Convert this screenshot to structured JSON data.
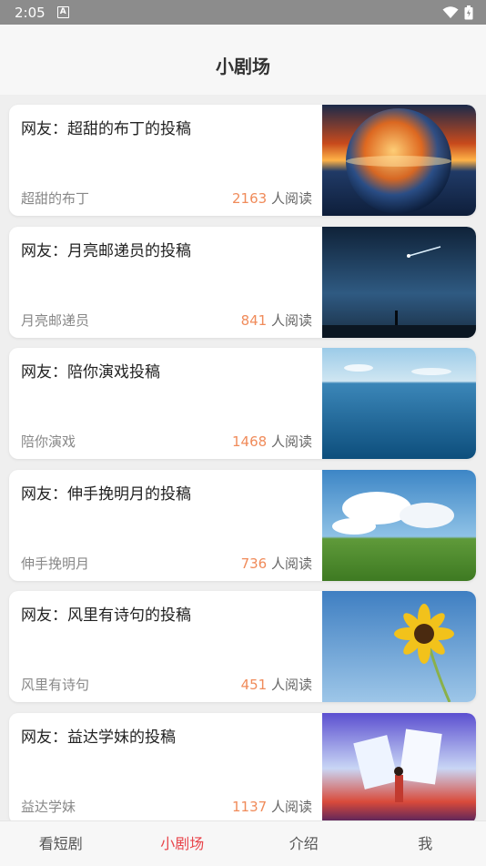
{
  "status": {
    "time": "2:05",
    "a_icon": "A"
  },
  "header": {
    "title": "小剧场"
  },
  "reads_suffix": "人阅读",
  "cards": [
    {
      "title": "网友：超甜的布丁的投稿",
      "author": "超甜的布丁",
      "reads": "2163",
      "image": "sunset-sphere"
    },
    {
      "title": "网友：月亮邮递员的投稿",
      "author": "月亮邮递员",
      "reads": "841",
      "image": "night-sky-meteor"
    },
    {
      "title": "网友：陪你演戏投稿",
      "author": "陪你演戏",
      "reads": "1468",
      "image": "ocean-horizon"
    },
    {
      "title": "网友：伸手挽明月的投稿",
      "author": "伸手挽明月",
      "reads": "736",
      "image": "grassland-clouds"
    },
    {
      "title": "网友：风里有诗句的投稿",
      "author": "风里有诗句",
      "reads": "451",
      "image": "sunflower-sky"
    },
    {
      "title": "网友：益达学妹的投稿",
      "author": "益达学妹",
      "reads": "1137",
      "image": "illustration-papers"
    }
  ],
  "tabs": [
    {
      "label": "看短剧",
      "active": false
    },
    {
      "label": "小剧场",
      "active": true
    },
    {
      "label": "介绍",
      "active": false
    },
    {
      "label": "我",
      "active": false
    }
  ],
  "colors": {
    "accent": "#e8464c",
    "read_count": "#f08b5a"
  }
}
